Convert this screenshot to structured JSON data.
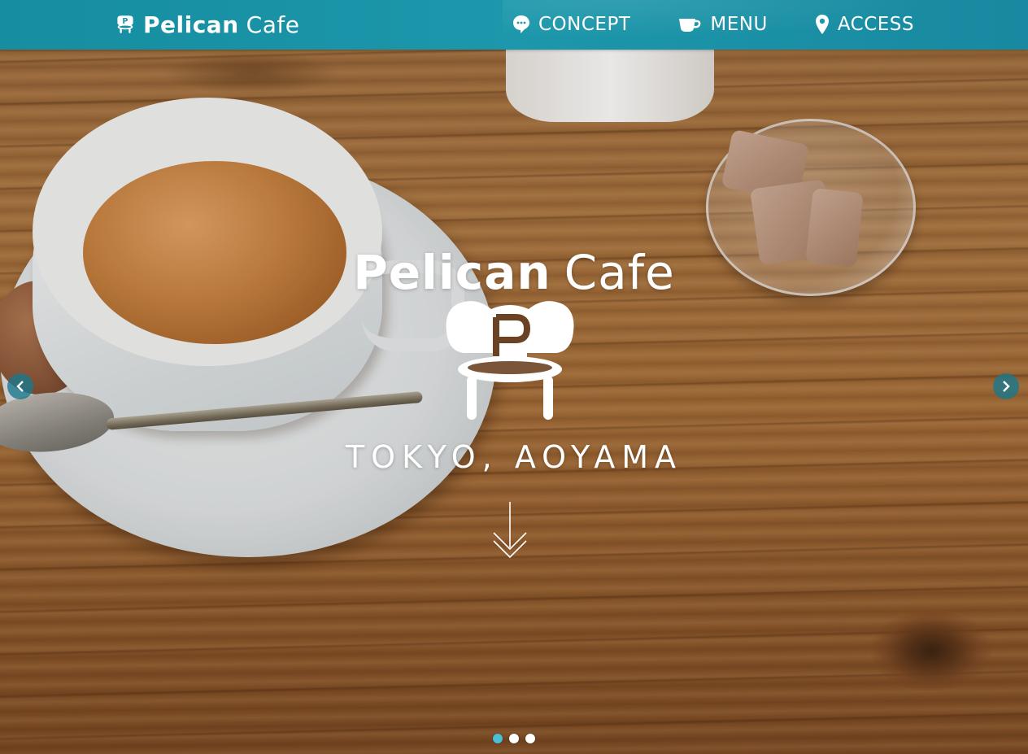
{
  "brand": {
    "bold": "Pelican",
    "light": "Cafe",
    "logo_icon": "chair-p-logo-icon"
  },
  "nav": [
    {
      "label": "CONCEPT",
      "icon": "speech-bubble-icon"
    },
    {
      "label": "MENU",
      "icon": "coffee-cup-icon"
    },
    {
      "label": "ACCESS",
      "icon": "map-pin-icon"
    }
  ],
  "hero": {
    "title_bold": "Pelican",
    "title_light": "Cafe",
    "logo_icon": "chair-p-logo-icon",
    "subtitle": "TOKYO, AOYAMA",
    "scroll_icon": "double-chevron-down-arrow-icon"
  },
  "slider": {
    "prev_icon": "chevron-left-icon",
    "next_icon": "chevron-right-icon",
    "dot_count": 3,
    "active_dot": 1
  },
  "colors": {
    "nav_bar": "#1c97ab",
    "active_dot": "#4cbfd6",
    "arrow_button": "#1a788c",
    "text": "#ffffff"
  }
}
